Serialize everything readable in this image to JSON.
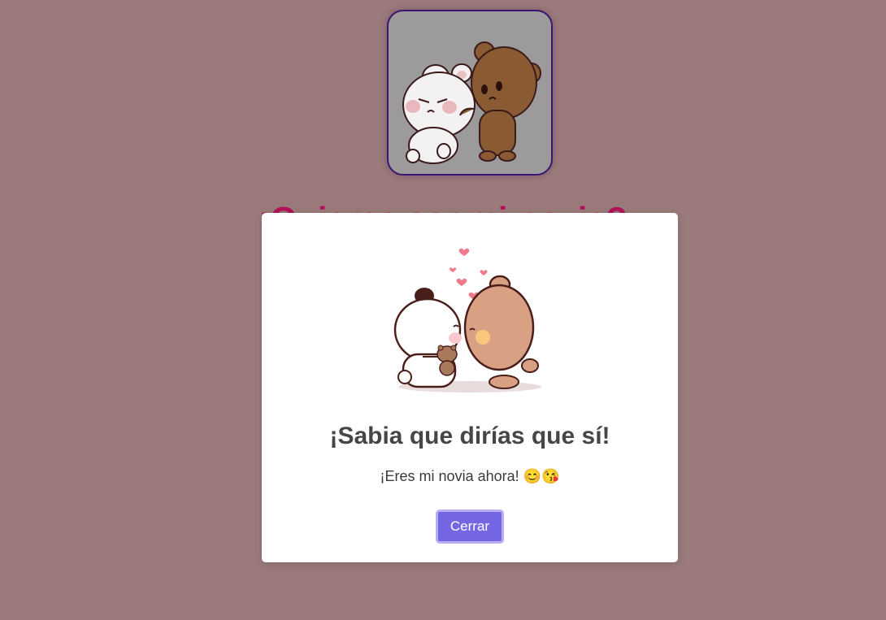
{
  "background": {
    "title": "¡Quieres ser mi novia?",
    "color": "#9a7a7a",
    "title_color": "#b3125a"
  },
  "top_image": {
    "alt": "bears-hug-image"
  },
  "modal": {
    "title": "¡Sabia que dirías que sí!",
    "message": "¡Eres mi novia ahora! 😊😘",
    "close_label": "Cerrar",
    "button_color": "#7566e3"
  }
}
